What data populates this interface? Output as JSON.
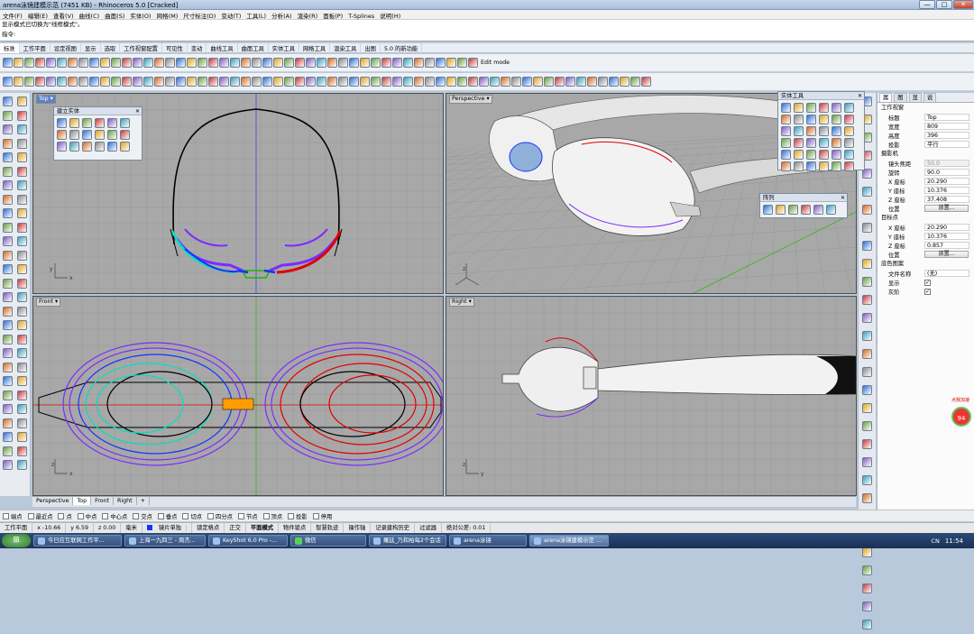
{
  "window": {
    "title": "arena泳镜建模示范 (7451 KB) - Rhinoceros 5.0 [Cracked]",
    "controls": [
      "—",
      "□",
      "✕"
    ]
  },
  "menu": [
    "文件(F)",
    "编辑(E)",
    "查看(V)",
    "曲线(C)",
    "曲面(S)",
    "实体(O)",
    "网格(M)",
    "尺寸标注(D)",
    "变动(T)",
    "工具(L)",
    "分析(A)",
    "渲染(R)",
    "面板(P)",
    "T-Splines",
    "说明(H)"
  ],
  "command": {
    "history_line": "显示模式已切换为\"线框模式\"。",
    "prompt": "指令:"
  },
  "toolbar_tabs": [
    "标准",
    "工作平面",
    "设定视图",
    "显示",
    "选取",
    "工作视窗配置",
    "可见性",
    "变动",
    "曲线工具",
    "曲面工具",
    "实体工具",
    "网格工具",
    "渲染工具",
    "出图",
    "5.0 的新功能"
  ],
  "toolbar_edit_mode": "Edit mode",
  "viewports": {
    "top": {
      "label": "Top"
    },
    "perspective": {
      "label": "Perspective"
    },
    "front": {
      "label": "Front"
    },
    "right": {
      "label": "Right"
    }
  },
  "floating": {
    "solids": "建立实体",
    "solid_tools": "实体工具",
    "array": "阵列"
  },
  "viewport_tabs": [
    "Perspective",
    "Top",
    "Front",
    "Right"
  ],
  "viewport_tabs_add": "+",
  "osnap": [
    "端点",
    "最近点",
    "点",
    "中点",
    "中心点",
    "交点",
    "垂点",
    "切点",
    "四分点",
    "节点",
    "顶点",
    "投影",
    "停用"
  ],
  "status": {
    "plane": "工作平面",
    "x": "x -10.66",
    "y": "y 6.59",
    "z": "z 0.00",
    "units": "毫米",
    "layer": "镜片单独",
    "items": [
      "锁定格点",
      "正交",
      "平面模式",
      "物件锁点",
      "智慧轨迹",
      "操作轴",
      "记录建构历史",
      "过滤器",
      "绝对公差: 0.01"
    ]
  },
  "properties": {
    "tabs": [
      "属",
      "图",
      "显",
      "说"
    ],
    "section_viewport": "工作视窗",
    "title_label": "标题",
    "title_value": "Top",
    "width_label": "宽度",
    "width_value": "809",
    "height_label": "高度",
    "height_value": "396",
    "projection_label": "投影",
    "projection_value": "平行",
    "section_camera": "摄影机",
    "lens_label": "镜头焦距",
    "lens_value": "50.0",
    "rotation_label": "旋转",
    "rotation_value": "90.0",
    "cam_x_label": "X 座标",
    "cam_x_value": "20.290",
    "cam_y_label": "Y 座标",
    "cam_y_value": "10.376",
    "cam_z_label": "Z 座标",
    "cam_z_value": "37.408",
    "position_label": "位置",
    "place_button": "放置...",
    "section_target": "目标点",
    "tgt_x_label": "X 座标",
    "tgt_x_value": "20.290",
    "tgt_y_label": "Y 座标",
    "tgt_y_value": "10.376",
    "tgt_z_label": "Z 座标",
    "tgt_z_value": "0.857",
    "tgt_position_label": "位置",
    "tgt_place_button": "放置...",
    "section_wallpaper": "底色图案",
    "file_label": "文件名称",
    "file_value": "(无)",
    "show_label": "显示",
    "gray_label": "灰阶"
  },
  "badge": {
    "text": "点我加速",
    "value": "94"
  },
  "taskbar": {
    "start": "⊞",
    "tasks": [
      "今日应互联网工作平...",
      "上海一九四三 - 周杰...",
      "KeyShot 6.0 Pro -...",
      "微信",
      "羅廷_乃和柏每2个会话",
      "arena泳镜",
      "arena泳镜建模示范 ..."
    ],
    "lang": "CN",
    "clock": "11:54"
  },
  "colors": {
    "viewport_bg": "#a8a8a8",
    "grid": "#9a9a9a",
    "active_label": "#5c80c7",
    "wire_black": "#000000",
    "wire_red": "#e00000",
    "wire_purple": "#7a2cff",
    "wire_cyan": "#00e0c0",
    "wire_blue": "#1533ff",
    "wire_green": "#1db800",
    "wire_orange": "#ff9d00"
  }
}
